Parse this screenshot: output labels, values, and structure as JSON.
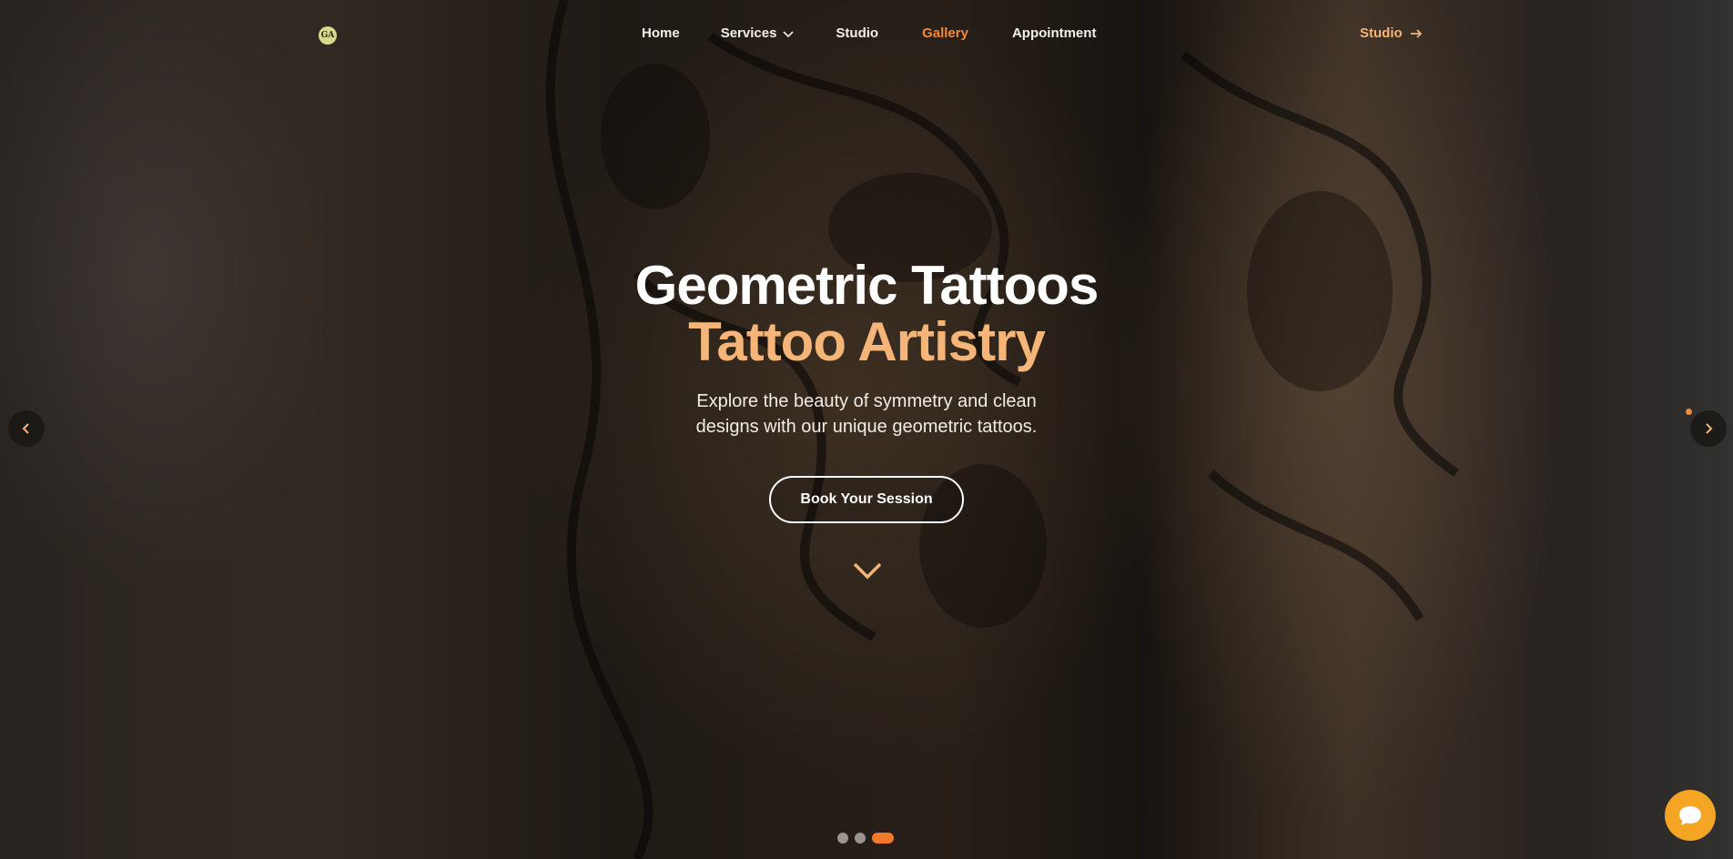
{
  "nav": {
    "logo_text": "GA",
    "links": [
      {
        "label": "Home"
      },
      {
        "label": "Services"
      },
      {
        "label": "Studio"
      },
      {
        "label": "Gallery"
      },
      {
        "label": "Appointment"
      }
    ],
    "active_link": "Gallery",
    "cta_label": "Studio"
  },
  "hero": {
    "title_line1": "Geometric Tattoos",
    "title_line2": "Tattoo Artistry",
    "subtitle": "Explore the beauty of symmetry and clean designs with our unique geometric tattoos.",
    "button_label": "Book Your Session"
  },
  "carousel": {
    "slide_count": 3,
    "active_slide": 3
  },
  "icons": {
    "dropdown": "chevron-down-icon",
    "cta": "arrow-right-icon",
    "scroll": "chevron-down-icon",
    "prev": "chevron-left-icon",
    "next": "chevron-right-icon",
    "chat": "chat-bubble-icon"
  },
  "colors": {
    "accent": "#f08a3a",
    "title_highlight": "#f6b578",
    "chat_button": "#f5a524"
  }
}
